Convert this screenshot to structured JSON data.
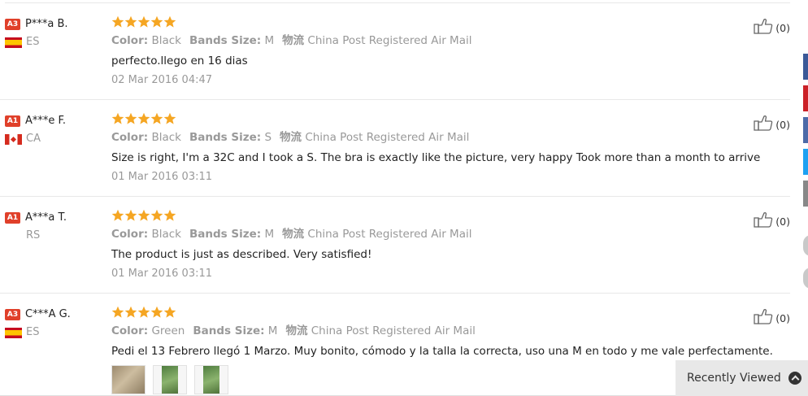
{
  "reviews": [
    {
      "badge": "A3",
      "buyer": "P***a B.",
      "flag": "es",
      "country": "ES",
      "rating": 5,
      "color_label": "Color:",
      "color_value": "Black",
      "size_label": "Bands Size:",
      "size_value": "M",
      "shipping_label": "物流",
      "shipping_value": "China Post Registered Air Mail",
      "text": "perfecto.llego en 16 dias",
      "date": "02 Mar 2016 04:47",
      "likes": "(0)",
      "photos": []
    },
    {
      "badge": "A1",
      "buyer": "A***e F.",
      "flag": "ca",
      "country": "CA",
      "rating": 5,
      "color_label": "Color:",
      "color_value": "Black",
      "size_label": "Bands Size:",
      "size_value": "S",
      "shipping_label": "物流",
      "shipping_value": "China Post Registered Air Mail",
      "text": "Size is right, I'm a 32C and I took a S. The bra is exactly like the picture, very happy Took more than a month to arrive",
      "date": "01 Mar 2016 03:11",
      "likes": "(0)",
      "photos": []
    },
    {
      "badge": "A1",
      "buyer": "A***a T.",
      "flag": "",
      "country": "RS",
      "rating": 5,
      "color_label": "Color:",
      "color_value": "Black",
      "size_label": "Bands Size:",
      "size_value": "M",
      "shipping_label": "物流",
      "shipping_value": "China Post Registered Air Mail",
      "text": "The product is just as described. Very satisfied!",
      "date": "01 Mar 2016 03:11",
      "likes": "(0)",
      "photos": []
    },
    {
      "badge": "A3",
      "buyer": "C***A G.",
      "flag": "es",
      "country": "ES",
      "rating": 5,
      "color_label": "Color:",
      "color_value": "Green",
      "size_label": "Bands Size:",
      "size_value": "M",
      "shipping_label": "物流",
      "shipping_value": "China Post Registered Air Mail",
      "text": "Pedi el 13 Febrero llegó 1 Marzo. Muy bonito, cómodo y la talla la correcta, uso una M en todo y me vale perfectamente.",
      "date": "",
      "likes": "(0)",
      "photos": [
        "photo-1",
        "photo-2",
        "photo-3"
      ]
    }
  ],
  "colors": {
    "badge": "#e0402a",
    "star": "#f5a623",
    "muted_text": "#999999",
    "share_tabs": [
      "#3b5998",
      "#cb2027",
      "#4c6aa8",
      "#1da1f2",
      "#888888"
    ]
  },
  "icons": {
    "like": "thumbs-up-icon",
    "recently_viewed": "chevron-up-circle-icon",
    "star": "star-icon"
  },
  "recently_viewed": {
    "label": "Recently Viewed"
  }
}
